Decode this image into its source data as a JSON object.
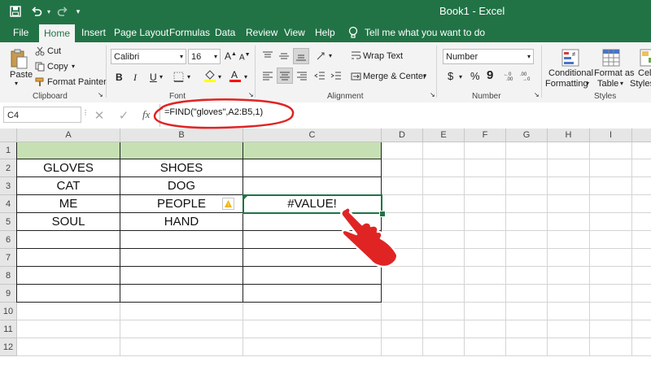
{
  "window": {
    "title": "Book1  -  Excel"
  },
  "qat": {
    "save_icon": "save-icon",
    "undo_icon": "undo-icon",
    "redo_icon": "redo-icon",
    "customize_icon": "customize-icon"
  },
  "tabs": [
    {
      "label": "File"
    },
    {
      "label": "Home"
    },
    {
      "label": "Insert"
    },
    {
      "label": "Page Layout"
    },
    {
      "label": "Formulas"
    },
    {
      "label": "Data"
    },
    {
      "label": "Review"
    },
    {
      "label": "View"
    },
    {
      "label": "Help"
    },
    {
      "label": "Tell me what you want to do"
    }
  ],
  "ribbon": {
    "paste": "Paste",
    "cut": "Cut",
    "copy": "Copy",
    "format_painter": "Format Painter",
    "clipboard_group": "Clipboard",
    "font_name": "Calibri",
    "font_size": "16",
    "bold": "B",
    "italic": "I",
    "underline": "U",
    "font_group": "Font",
    "wrap_text": "Wrap Text",
    "merge_center": "Merge & Center",
    "alignment_group": "Alignment",
    "number_format": "Number",
    "currency": "$",
    "percent": "%",
    "comma": "9",
    "number_group": "Number",
    "conditional_1": "Conditional",
    "conditional_2": "Formatting",
    "format_table_1": "Format as",
    "format_table_2": "Table",
    "cell_styles_1": "Cell",
    "cell_styles_2": "Styles",
    "styles_group": "Styles",
    "font_color": "#ff0000",
    "fill_color": "#ffff00"
  },
  "formula_bar": {
    "name_box": "C4",
    "fx": "fx",
    "formula": "=FIND(\"gloves\",A2:B5,1)"
  },
  "grid": {
    "columns": [
      "A",
      "B",
      "C",
      "D",
      "E",
      "F",
      "G",
      "H",
      "I"
    ],
    "rows": [
      "1",
      "2",
      "3",
      "4",
      "5",
      "6",
      "7",
      "8",
      "9",
      "10",
      "11",
      "12"
    ],
    "data": [
      [
        "",
        "",
        ""
      ],
      [
        "GLOVES",
        "SHOES",
        ""
      ],
      [
        "CAT",
        "DOG",
        ""
      ],
      [
        "ME",
        "PEOPLE",
        "#VALUE!"
      ],
      [
        "SOUL",
        "HAND",
        ""
      ]
    ],
    "header_fill": "#c6e0b4",
    "error_icon": "error-warning-icon"
  },
  "annotation": {
    "circle_color": "#e02424",
    "hand_icon": "pointing-hand-icon"
  }
}
